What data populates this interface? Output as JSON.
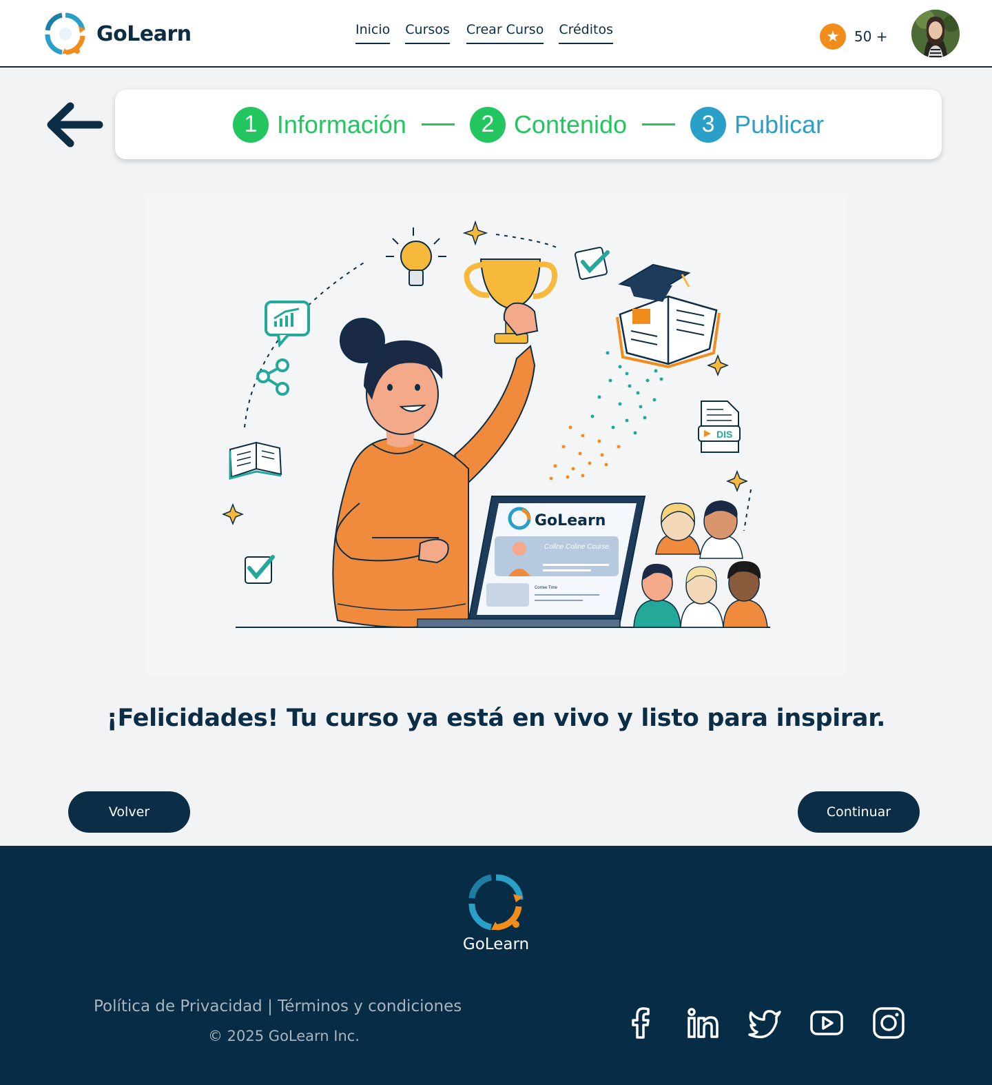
{
  "header": {
    "brand": "GoLearn",
    "nav": [
      "Inicio",
      "Cursos",
      "Crear Curso",
      "Créditos"
    ],
    "credits": "50 +"
  },
  "stepper": {
    "steps": [
      {
        "num": "1",
        "label": "Información",
        "color": "#22c55e"
      },
      {
        "num": "2",
        "label": "Contenido",
        "color": "#22c55e"
      },
      {
        "num": "3",
        "label": "Publicar",
        "color": "#2a9fc7"
      }
    ],
    "line_color": "#22c55e"
  },
  "illustration": {
    "screen_brand": "GoLearn",
    "screen_card_title": "Coline Coline Ccurse",
    "screen_card_sub": "Corree Time",
    "doc_tag": "DIS"
  },
  "main": {
    "headline": "¡Felicidades! Tu curso ya está en vivo y listo para inspirar.",
    "back_label": "Volver",
    "continue_label": "Continuar"
  },
  "footer": {
    "brand": "GoLearn",
    "privacy": "Política de Privacidad",
    "separator": " | ",
    "terms": "Términos y condiciones",
    "copyright": "© 2025 GoLearn Inc.",
    "socials": [
      "facebook-icon",
      "linkedin-icon",
      "twitter-icon",
      "youtube-icon",
      "instagram-icon"
    ]
  },
  "colors": {
    "navy": "#0b2d45",
    "footer_bg": "#062d45",
    "accent_orange": "#f28c1b",
    "accent_green": "#22c55e",
    "accent_blue": "#2a9fc7"
  }
}
